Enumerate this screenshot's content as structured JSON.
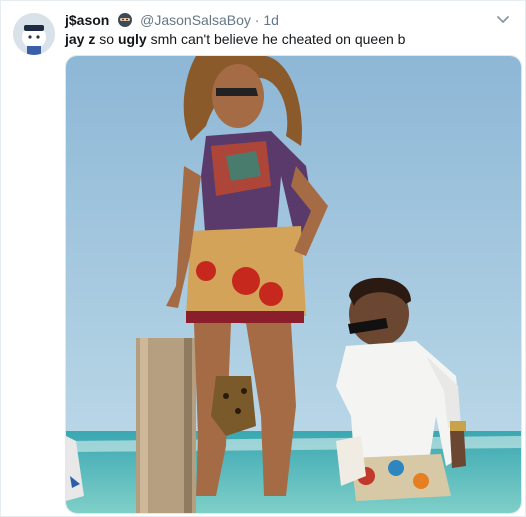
{
  "tweet": {
    "display_name": "j$ason",
    "emoji_icon": "ninja-emoji-icon",
    "handle": "@JasonSalsaBoy",
    "separator": "·",
    "timestamp": "1d",
    "text": {
      "part1": "jay z",
      "part2": " so ",
      "part3": "ugly",
      "part4": " smh can't believe he cheated on queen b"
    },
    "menu_icon": "chevron-down-icon",
    "media_kind": "photo"
  },
  "colors": {
    "text": "#14171a",
    "secondary": "#657786",
    "sky": "#9fc3dc",
    "sea": "#4fb7bd"
  }
}
